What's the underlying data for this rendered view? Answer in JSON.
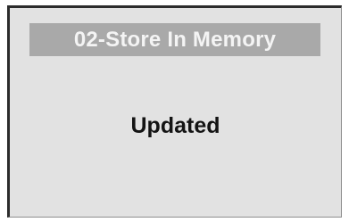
{
  "screen": {
    "title": "02-Store In Memory",
    "message": "Updated"
  },
  "colors": {
    "screen_background": "#e2e2e2",
    "title_bar": "#a9a9a9",
    "title_text": "#f4f4f4",
    "message_text": "#141414",
    "frame_dark": "#2c2c2c"
  }
}
